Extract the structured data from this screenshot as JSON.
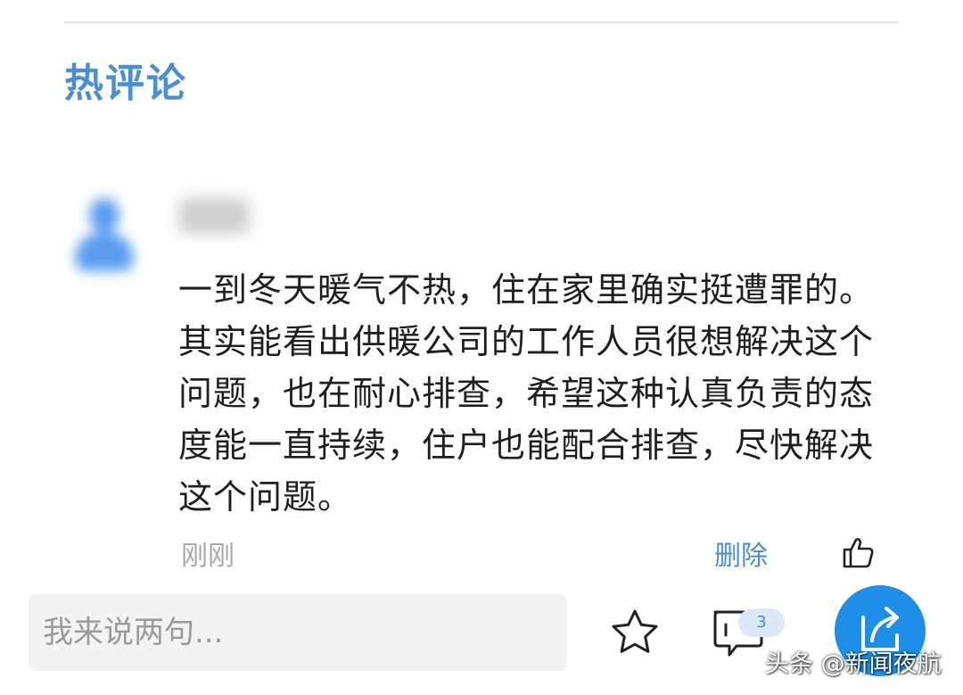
{
  "section": {
    "title": "热评论"
  },
  "comment": {
    "text": "一到冬天暖气不热，住在家里确实挺遭罪的。其实能看出供暖公司的工作人员很想解决这个问题，也在耐心排查，希望这种认真负责的态度能一直持续，住户也能配合排查，尽快解决这个问题。",
    "time": "刚刚",
    "delete_label": "删除"
  },
  "bottom_bar": {
    "input_placeholder": "我来说两句...",
    "comment_count": "3"
  },
  "watermark": {
    "text": "头条 @新闻夜航"
  },
  "colors": {
    "accent": "#4a8fd4",
    "share_button": "#1f8ee8",
    "text": "#1f1f1f",
    "muted": "#a8a8a8"
  },
  "icons": {
    "like": "thumbs-up-icon",
    "favorite": "star-icon",
    "comments": "comment-bubble-icon",
    "share": "share-arrow-icon"
  }
}
